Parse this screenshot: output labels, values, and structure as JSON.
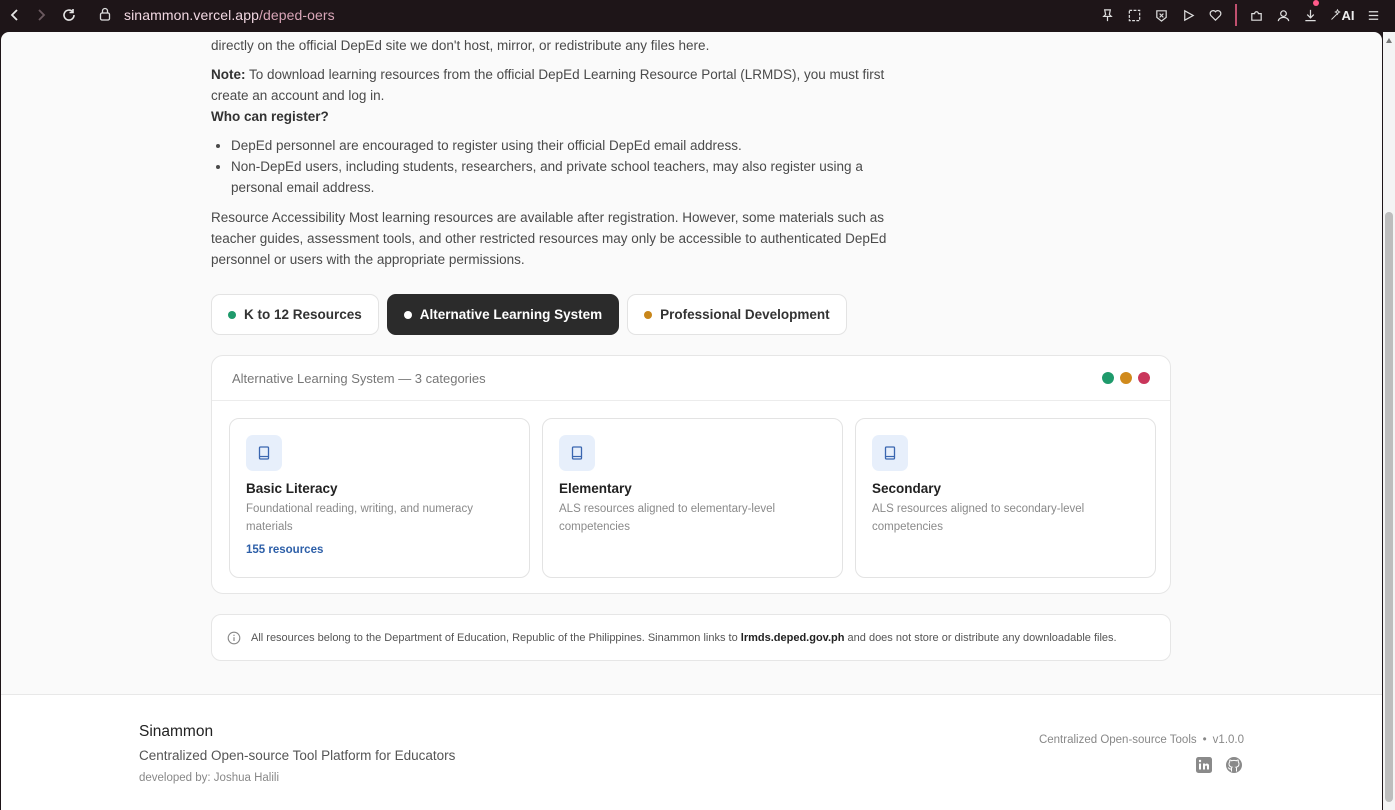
{
  "browser": {
    "url_host": "sinammon.vercel.app",
    "url_path": "/deped-oers",
    "ai_label": "AI"
  },
  "intro": {
    "p1": "directly on the official DepEd site we don't host, mirror, or redistribute any files here.",
    "note_label": "Note:",
    "note_text": " To download learning resources from the official DepEd Learning Resource Portal (LRMDS), you must first create an account and log in.",
    "who_heading": "Who can register?",
    "bullets": [
      "DepEd personnel are encouraged to register using their official DepEd email address.",
      "Non-DepEd users, including students, researchers, and private school teachers, may also register using a personal email address."
    ],
    "accessibility": "Resource Accessibility Most learning resources are available after registration. However, some materials such as teacher guides, assessment tools, and other restricted resources may only be accessible to authenticated DepEd personnel or users with the appropriate permissions."
  },
  "tabs": [
    {
      "label": "K to 12 Resources",
      "dot_color": "#1e9a6b",
      "active": false
    },
    {
      "label": "Alternative Learning System",
      "dot_color": "#ffffff",
      "active": true
    },
    {
      "label": "Professional Development",
      "dot_color": "#c8861a",
      "active": false
    }
  ],
  "panel": {
    "header": "Alternative Learning System — 3 categories",
    "dot_colors": [
      "#1e9a6b",
      "#d08a1c",
      "#c9365b"
    ],
    "cards": [
      {
        "title": "Basic Literacy",
        "desc": "Foundational reading, writing, and numeracy materials",
        "count": "155 resources"
      },
      {
        "title": "Elementary",
        "desc": "ALS resources aligned to elementary-level competencies",
        "count": ""
      },
      {
        "title": "Secondary",
        "desc": "ALS resources aligned to secondary-level competencies",
        "count": ""
      }
    ]
  },
  "notice": {
    "text_before": "All resources belong to the Department of Education, Republic of the Philippines. Sinammon links to ",
    "link": "lrmds.deped.gov.ph",
    "text_after": " and does not store or distribute any downloadable files."
  },
  "footer": {
    "title": "Sinammon",
    "subtitle": "Centralized Open-source Tool Platform for Educators",
    "developer": "developed by: Joshua Halili",
    "tagline": "Centralized Open-source Tools",
    "bullet": "•",
    "version": "v1.0.0"
  }
}
